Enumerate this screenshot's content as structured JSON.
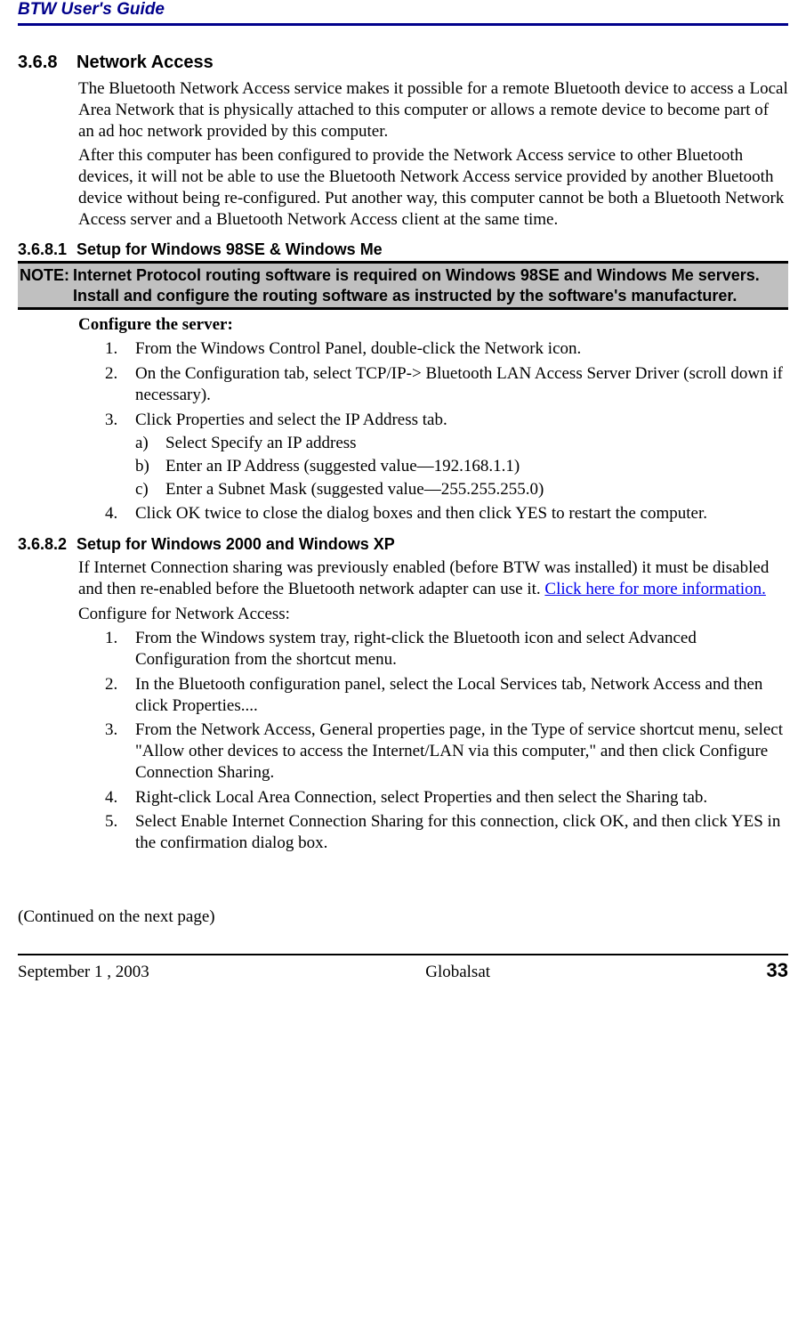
{
  "header": {
    "title": "BTW User's Guide"
  },
  "s368": {
    "num": "3.6.8",
    "title": "Network Access",
    "para1": "The Bluetooth Network Access service makes it possible for a remote Bluetooth device to access a Local Area Network that is physically attached to this computer or allows a remote device to become part of an ad hoc network provided by this computer.",
    "para2": "After this computer has been configured to provide the Network Access service to other Bluetooth devices, it will not be able to use the Bluetooth Network Access service provided by another Bluetooth device without being re-configured. Put another way, this computer cannot be both a Bluetooth Network Access server and a Bluetooth Network Access client at the same time."
  },
  "s3681": {
    "num": "3.6.8.1",
    "title": "Setup for Windows 98SE & Windows Me",
    "note_label": "NOTE:",
    "note_line1": "Internet Protocol routing software is required on Windows 98SE and Windows Me servers.",
    "note_line2": "Install and configure the routing software as instructed by the software's manufacturer.",
    "configure": "Configure the server:",
    "items": [
      {
        "n": "1.",
        "t": "From the Windows Control Panel, double-click the Network icon."
      },
      {
        "n": "2.",
        "t": "On the Configuration tab, select TCP/IP-> Bluetooth LAN Access Server Driver (scroll down if necessary)."
      },
      {
        "n": "3.",
        "t": "Click Properties and select the IP Address tab."
      }
    ],
    "subitems": [
      {
        "n": "a)",
        "t": "Select Specify an IP address"
      },
      {
        "n": "b)",
        "t": "Enter an IP Address (suggested value—192.168.1.1)"
      },
      {
        "n": "c)",
        "t": "Enter a Subnet Mask (suggested value—255.255.255.0)"
      }
    ],
    "item4": {
      "n": "4.",
      "t": "Click OK twice to close the dialog boxes and then click YES to restart the computer."
    }
  },
  "s3682": {
    "num": "3.6.8.2",
    "title": "Setup for Windows 2000 and Windows XP",
    "para1a": "If Internet Connection sharing was previously enabled (before BTW was installed) it must be disabled and then re-enabled before the Bluetooth network adapter can use it. ",
    "link": "Click here for more information.",
    "para2": "Configure for Network Access:",
    "items": [
      {
        "n": "1.",
        "t": "From the Windows system tray, right-click the Bluetooth icon and select Advanced Configuration from the shortcut menu."
      },
      {
        "n": "2.",
        "t": "In the Bluetooth configuration panel, select the Local Services tab, Network Access and then click Properties...."
      },
      {
        "n": "3.",
        "t": "From the Network Access, General properties page, in the Type of service shortcut menu, select \"Allow other devices to access the Internet/LAN via this computer,\" and then click Configure Connection Sharing."
      },
      {
        "n": "4.",
        "t": "Right-click Local Area Connection, select Properties and then select the Sharing tab."
      },
      {
        "n": "5.",
        "t": "Select Enable Internet Connection Sharing for this connection, click OK, and then click YES in the confirmation dialog box."
      }
    ]
  },
  "continued": "(Continued on the next page)",
  "footer": {
    "left": "September 1 , 2003",
    "center": "Globalsat",
    "right": "33"
  }
}
